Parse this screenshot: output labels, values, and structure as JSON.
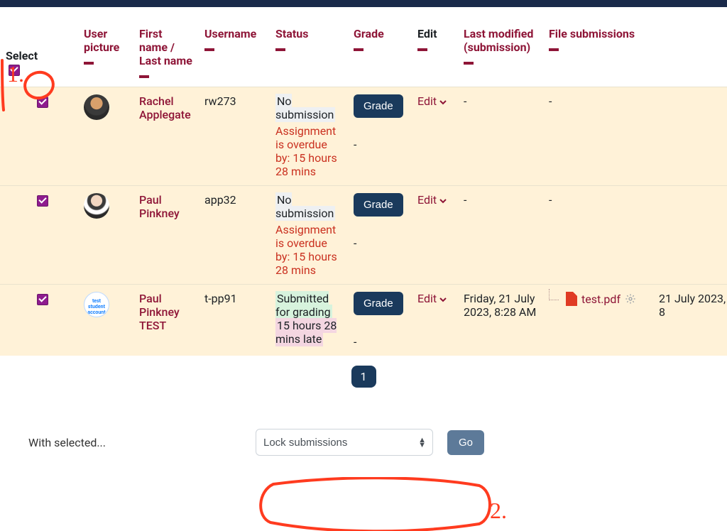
{
  "annotations": {
    "label1": "1.",
    "label2": "2."
  },
  "headers": {
    "select": "Select",
    "user_picture": "User picture",
    "first_last": "First name / Last name",
    "username": "Username",
    "status": "Status",
    "grade": "Grade",
    "edit": "Edit",
    "last_modified": "Last modified (submission)",
    "file_submissions": "File submissions"
  },
  "buttons": {
    "grade": "Grade",
    "edit": "Edit",
    "go": "Go"
  },
  "status_text": {
    "no_submission": "No submission",
    "overdue": "Assignment is overdue by: 15 hours 28 mins",
    "submitted": "Submitted for grading",
    "late": "15 hours 28 mins late"
  },
  "rows": [
    {
      "name": "Rachel Applegate",
      "username": "rw273",
      "status_type": "none",
      "grade_value": "-",
      "last_modified": "-",
      "files": null,
      "file_date": null,
      "avatar": "person1"
    },
    {
      "name": "Paul Pinkney",
      "username": "app32",
      "status_type": "none",
      "grade_value": "-",
      "last_modified": "-",
      "files": null,
      "file_date": null,
      "avatar": "person2"
    },
    {
      "name": "Paul Pinkney TEST",
      "username": "t-pp91",
      "status_type": "submitted",
      "grade_value": "-",
      "last_modified": "Friday, 21 July 2023, 8:28 AM",
      "files": "test.pdf",
      "file_date": "21 July 2023, 8",
      "avatar": "testacct",
      "avatar_text": "test student account"
    }
  ],
  "pager": {
    "current": "1"
  },
  "bulk": {
    "label": "With selected...",
    "selected_option": "Lock submissions"
  }
}
